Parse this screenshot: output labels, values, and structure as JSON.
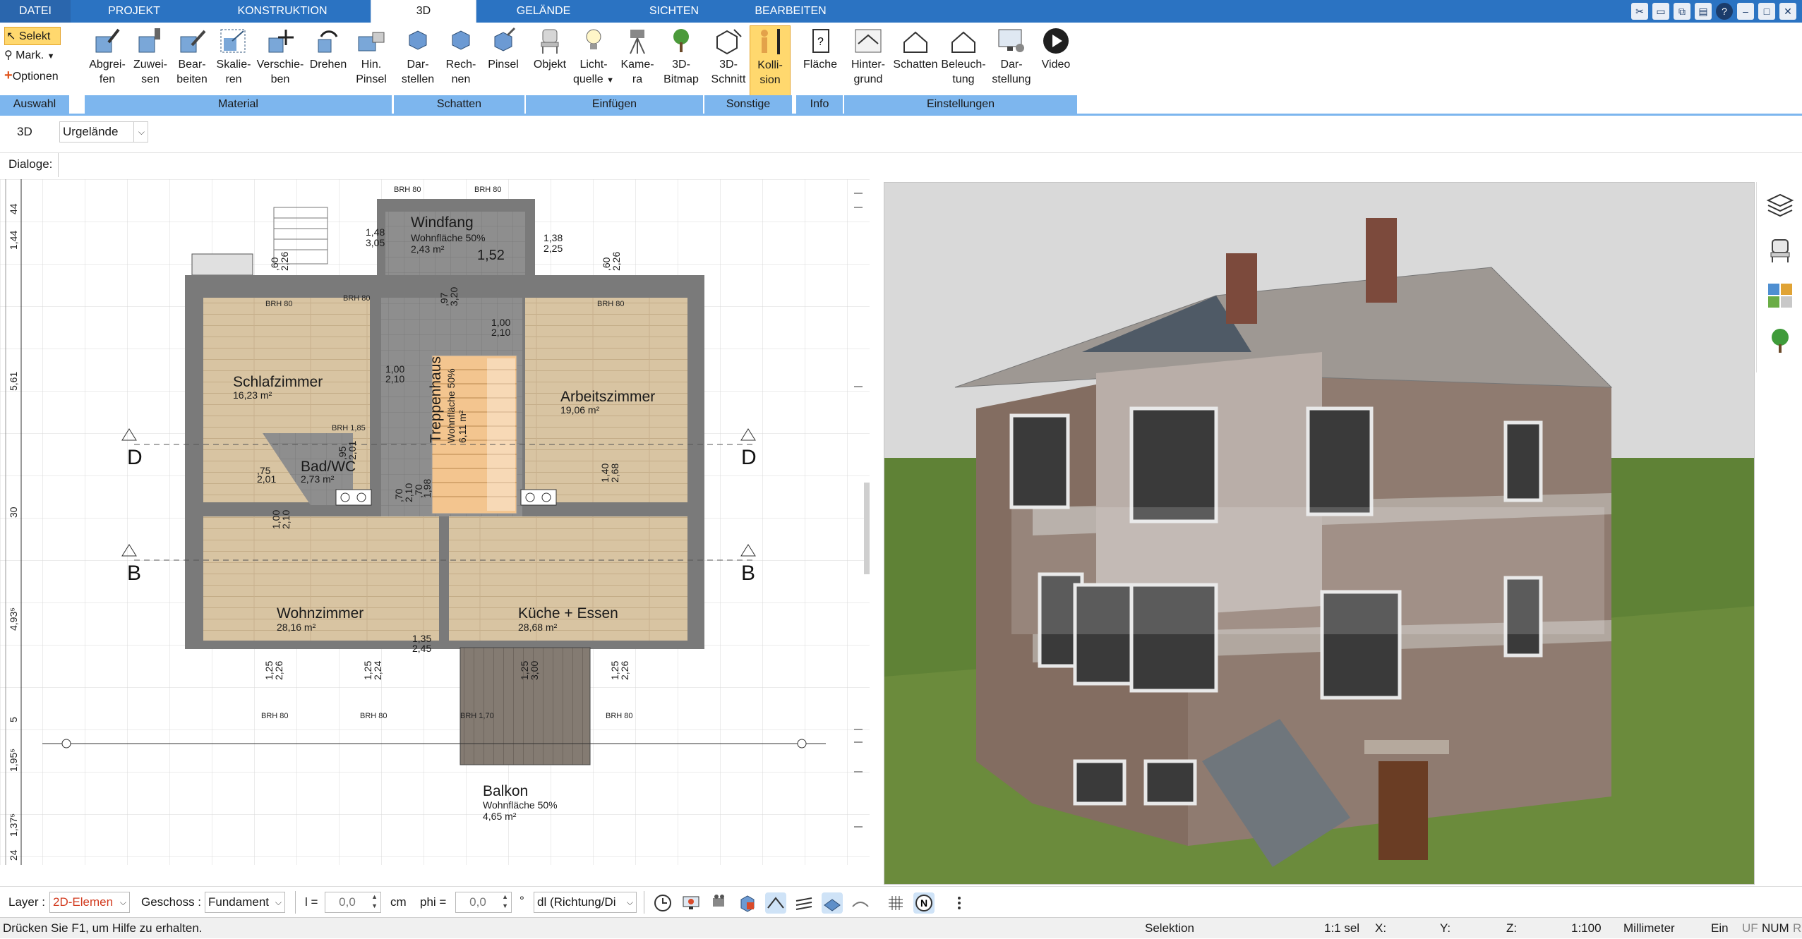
{
  "tabs": [
    {
      "label": "DATEI"
    },
    {
      "label": "PROJEKT"
    },
    {
      "label": "KONSTRUKTION"
    },
    {
      "label": "3D"
    },
    {
      "label": "GELÄNDE"
    },
    {
      "label": "SICHTEN"
    },
    {
      "label": "BEARBEITEN"
    }
  ],
  "active_tab": "3D",
  "ribbon": {
    "auswahl": {
      "label": "Auswahl",
      "selekt": "Selekt",
      "mark": "Mark.",
      "optionen": "Optionen"
    },
    "material": {
      "label": "Material",
      "buttons": [
        {
          "l1": "Abgrei-",
          "l2": "fen"
        },
        {
          "l1": "Zuwei-",
          "l2": "sen"
        },
        {
          "l1": "Bear-",
          "l2": "beiten"
        },
        {
          "l1": "Skalie-",
          "l2": "ren"
        },
        {
          "l1": "Verschie-",
          "l2": "ben"
        },
        {
          "l1": "Drehen",
          "l2": ""
        },
        {
          "l1": "Hin.",
          "l2": "Pinsel"
        }
      ]
    },
    "schatten": {
      "label": "Schatten",
      "buttons": [
        {
          "l1": "Dar-",
          "l2": "stellen"
        },
        {
          "l1": "Rech-",
          "l2": "nen"
        },
        {
          "l1": "Pinsel",
          "l2": ""
        }
      ]
    },
    "einfuegen": {
      "label": "Einfügen",
      "buttons": [
        {
          "l1": "Objekt",
          "l2": ""
        },
        {
          "l1": "Licht-",
          "l2": "quelle"
        },
        {
          "l1": "Kame-",
          "l2": "ra"
        },
        {
          "l1": "3D-",
          "l2": "Bitmap"
        }
      ]
    },
    "sonstige": {
      "label": "Sonstige",
      "buttons": [
        {
          "l1": "3D-",
          "l2": "Schnitt"
        },
        {
          "l1": "Kolli-",
          "l2": "sion"
        }
      ]
    },
    "info": {
      "label": "Info",
      "buttons": [
        {
          "l1": "Fläche",
          "l2": ""
        }
      ]
    },
    "einstellungen": {
      "label": "Einstellungen",
      "buttons": [
        {
          "l1": "Hinter-",
          "l2": "grund"
        },
        {
          "l1": "Schatten",
          "l2": ""
        },
        {
          "l1": "Beleuch-",
          "l2": "tung"
        },
        {
          "l1": "Dar-",
          "l2": "stellung"
        },
        {
          "l1": "Video",
          "l2": ""
        }
      ]
    }
  },
  "optbar": {
    "mode": "3D",
    "terrain": "Urgelände"
  },
  "dialogbar": {
    "label": "Dialoge:"
  },
  "plan": {
    "rooms": [
      {
        "name": "Windfang",
        "sub": "Wohnfläche  50%",
        "area": "2,43 m²"
      },
      {
        "name": "Schlafzimmer",
        "sub": "",
        "area": "16,23 m²"
      },
      {
        "name": "Treppenhaus",
        "sub": "Wohnfläche  50%",
        "area": "6,11 m²"
      },
      {
        "name": "Arbeitszimmer",
        "sub": "",
        "area": "19,06 m²"
      },
      {
        "name": "Bad/WC",
        "sub": "",
        "area": "2,73 m²"
      },
      {
        "name": "Wohnzimmer",
        "sub": "",
        "area": "28,16 m²"
      },
      {
        "name": "Küche + Essen",
        "sub": "",
        "area": "28,68 m²"
      },
      {
        "name": "Balkon",
        "sub": "Wohnfläche  50%",
        "area": "4,65 m²"
      }
    ],
    "section_marks": [
      "D",
      "D",
      "B",
      "B"
    ],
    "dims": {
      "d1": "1,48",
      "d1b": "3,05",
      "d2": "1,38",
      "d2b": "2,25",
      "d3": "1,52",
      "d4": "1,00",
      "d4b": "2,10",
      "d5": "1,00",
      "d5b": "2,10",
      "d6": "1,00",
      "d6b": "2,10",
      "d7": "1,35",
      "d7b": "2,45",
      "d8": "1,40",
      "d8b": "2,68",
      "d9": ",75",
      "d9b": "2,01",
      "d10": ",60",
      "d10b": "2,26",
      "d11": ",60",
      "d11b": "2,26",
      "d12": "1,25",
      "d12b": "2,26",
      "d13": "1,25",
      "d13b": "2,24",
      "d14": "1,25",
      "d14b": "3,00",
      "d15": "1,25",
      "d15b": "2,26",
      "d16": ",97",
      "d16b": "3,20",
      "d17": ",95",
      "d17b": "2,01",
      "d18": ",70",
      "d18b": "2,10",
      "d19": ",70",
      "d19b": "1,98"
    },
    "brh": [
      "BRH 80",
      "BRH 80",
      "BRH 80",
      "BRH 80",
      "BRH 1,85",
      "BRH 80",
      "BRH 80",
      "BRH 1,70",
      "BRH 80",
      "BRH 80"
    ],
    "ruler": [
      "44",
      "1,44",
      "5,61",
      "30",
      "4,93⁵",
      "5",
      "1,95⁵",
      "1,37⁵",
      "24"
    ]
  },
  "propbar": {
    "layer_label": "Layer :",
    "layer_value": "2D-Elemen",
    "geschoss_label": "Geschoss :",
    "geschoss_value": "Fundament",
    "l_label": "l =",
    "l_value": "0,0",
    "l_unit": "cm",
    "phi_label": "phi =",
    "phi_value": "0,0",
    "phi_unit": "°",
    "dir_value": "dl (Richtung/Di"
  },
  "status": {
    "help": "Drücken Sie F1, um Hilfe zu erhalten.",
    "mode": "Selektion",
    "sel": "1:1 sel",
    "x": "X:",
    "y": "Y:",
    "z": "Z:",
    "scale": "1:100",
    "unit": "Millimeter",
    "ein": "Ein",
    "uf": "UF",
    "num": "NUM",
    "ri": "RI"
  },
  "colors": {
    "accent": "#2b73c2",
    "ribbon_label": "#7db6ee",
    "active_btn": "#ffd86e",
    "wall": "#7a7a7a",
    "floor_wood": "#d9c4a3",
    "grass": "#6b8b3c"
  }
}
